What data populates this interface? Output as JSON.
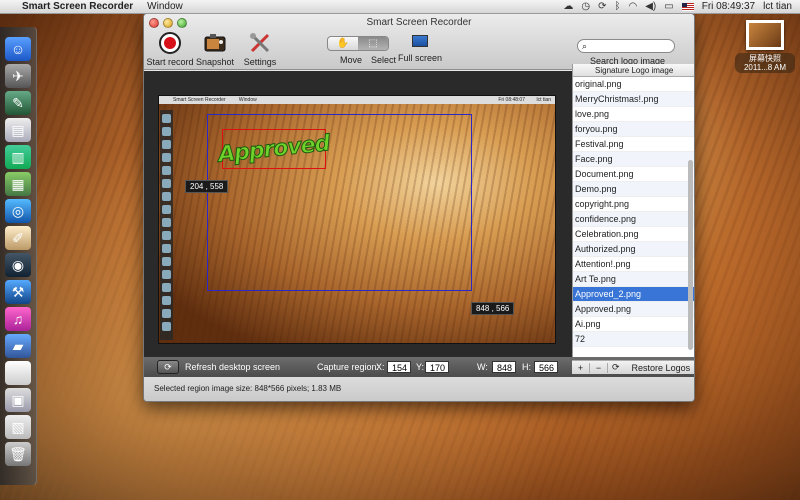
{
  "menubar": {
    "app_name": "Smart Screen Recorder",
    "window_menu": "Window",
    "clock": "Fri 08:49:37",
    "user": "lct tian"
  },
  "desktop_file": {
    "label_line1": "屏幕快照",
    "label_line2": "2011...8 AM"
  },
  "window": {
    "title": "Smart Screen Recorder",
    "toolbar": {
      "start_record": "Start record",
      "snapshot": "Snapshot",
      "settings": "Settings",
      "move": "Move",
      "select": "Select",
      "full_screen": "Full screen"
    },
    "search": {
      "placeholder": "",
      "label": "Search logo image"
    },
    "capture": {
      "logo_text": "Approved",
      "coord_top_left": "204 , 558",
      "coord_bottom_right": "848 , 566",
      "shot_menubar_app": "Smart Screen Recorder",
      "shot_menubar_window": "Window",
      "shot_clock": "Fri 08:48:07",
      "shot_user": "lct tian"
    },
    "bottom_bar": {
      "refresh_label": "Refresh desktop screen",
      "capture_region_label": "Capture region:",
      "x_label": "X:",
      "x_value": "154",
      "y_label": "Y:",
      "y_value": "170",
      "w_label": "W:",
      "w_value": "848",
      "h_label": "H:",
      "h_value": "566"
    },
    "status": "Selected region image size: 848*566 pixels;  1.83 MB",
    "panel": {
      "header": "Signature Logo image",
      "items": [
        "original.png",
        "MerryChristmas!.png",
        "love.png",
        "foryou.png",
        "Festival.png",
        "Face.png",
        "Document.png",
        "Demo.png",
        "copyright.png",
        "confidence.png",
        "Celebration.png",
        "Authorized.png",
        "Attention!.png",
        "Art Te.png",
        "Approved_2.png",
        "Approved.png",
        "Ai.png",
        "72"
      ],
      "selected_index": 14,
      "add_label": "+",
      "remove_label": "−",
      "restore_label": "Restore Logos"
    }
  }
}
